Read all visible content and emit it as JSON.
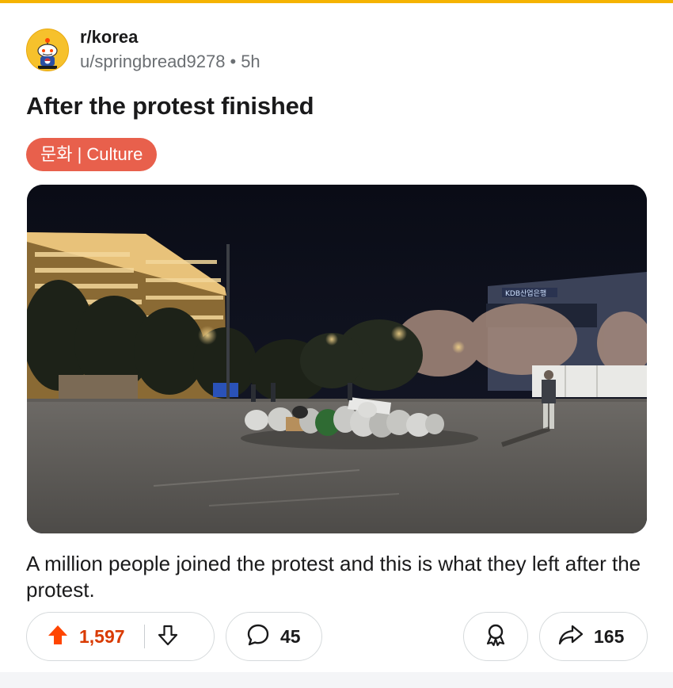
{
  "post": {
    "subreddit": "r/korea",
    "author": "u/springbread9278",
    "separator": "•",
    "age": "5h",
    "title": "After the protest finished",
    "flair": "문화 | Culture",
    "body": "A million people joined the protest and this is what they left after the protest.",
    "image_signs": {
      "building_sign": "KDB산업은행"
    }
  },
  "actions": {
    "upvotes": "1,597",
    "comments": "45",
    "shares": "165"
  },
  "colors": {
    "accent": "#f5b301",
    "flair_bg": "#e8604c",
    "upvote": "#ff4500",
    "vote_count": "#d93a00"
  },
  "icons": {
    "upvote": "arrow-up-icon",
    "downvote": "arrow-down-icon",
    "comment": "comment-bubble-icon",
    "award": "award-icon",
    "share": "share-arrow-icon"
  }
}
